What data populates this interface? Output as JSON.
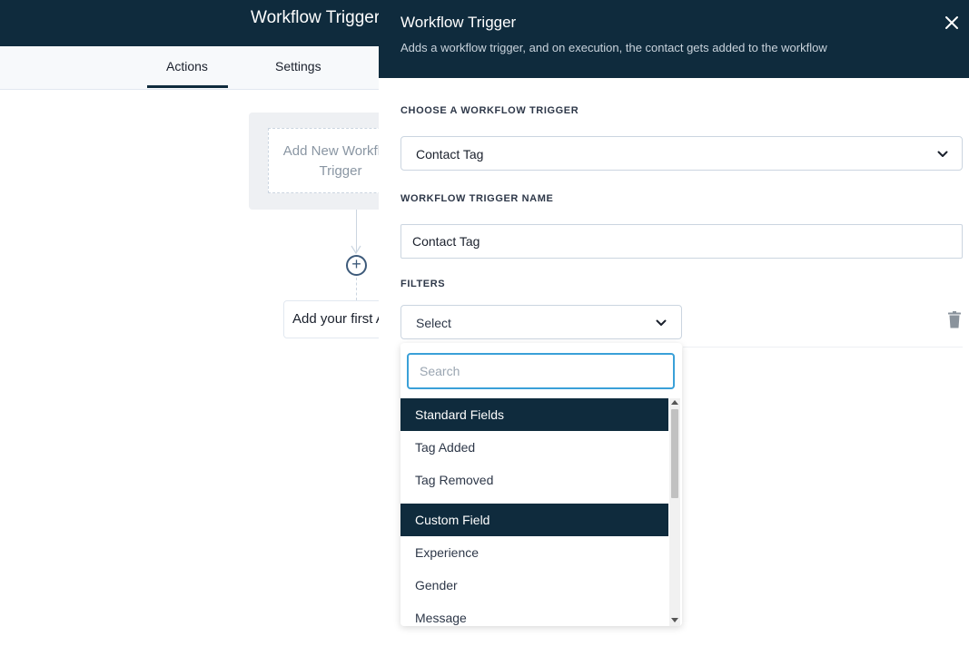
{
  "app": {
    "title": "Workflow Trigger",
    "tabs": [
      {
        "label": "Actions",
        "active": true
      },
      {
        "label": "Settings",
        "active": false
      }
    ]
  },
  "canvas": {
    "trigger_placeholder": "Add New Workflow Trigger",
    "first_action": "Add your first Action"
  },
  "panel": {
    "title": "Workflow Trigger",
    "subtitle": "Adds a workflow trigger, and on execution, the contact gets added to the workflow",
    "choose_label": "CHOOSE A WORKFLOW TRIGGER",
    "choose_value": "Contact Tag",
    "name_label": "WORKFLOW TRIGGER NAME",
    "name_value": "Contact Tag",
    "filters_label": "FILTERS",
    "filter_select_value": "Select",
    "dropdown": {
      "search_placeholder": "Search",
      "groups": [
        {
          "label": "Standard Fields",
          "items": [
            "Tag Added",
            "Tag Removed"
          ]
        },
        {
          "label": "Custom Field",
          "items": [
            "Experience",
            "Gender",
            "Message"
          ]
        }
      ]
    }
  },
  "colors": {
    "header_bg": "#0f2b3d",
    "accent_focus": "#3aa0d8",
    "group_bg": "#0f2b3d"
  },
  "icons": [
    "close-icon",
    "chevron-down-icon",
    "trash-icon",
    "plus-circle-icon",
    "arrow-down-icon"
  ]
}
